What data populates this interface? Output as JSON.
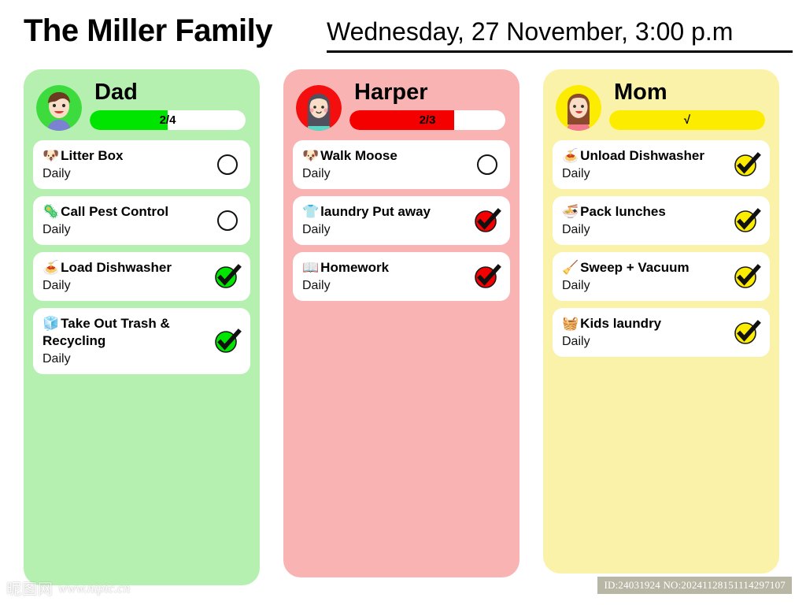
{
  "header": {
    "family_title": "The Miller Family",
    "date": "Wednesday, 27 November, 3:00 p.m"
  },
  "columns": [
    {
      "id": "dad",
      "name": "Dad",
      "panel_color": "#b6f0b0",
      "accent_color": "#00e500",
      "avatar_bg": "#3ddb3d",
      "progress": {
        "label": "2/4",
        "completed": 2,
        "total": 4,
        "percent": 50,
        "fill_color": "#00e500"
      },
      "tasks": [
        {
          "emoji": "🐶",
          "emoji_name": "dog-face-icon",
          "title": "Litter Box",
          "frequency": "Daily",
          "done": false
        },
        {
          "emoji": "🦠",
          "emoji_name": "microbe-icon",
          "title": "Call Pest Control",
          "frequency": "Daily",
          "done": false
        },
        {
          "emoji": "🍝",
          "emoji_name": "spaghetti-icon",
          "title": "Load Dishwasher",
          "frequency": "Daily",
          "done": true
        },
        {
          "emoji": "🧊",
          "emoji_name": "ice-cube-icon",
          "title": "Take Out Trash & Recycling",
          "frequency": "Daily",
          "done": true
        }
      ]
    },
    {
      "id": "harper",
      "name": "Harper",
      "panel_color": "#f9b3b3",
      "accent_color": "#f40000",
      "avatar_bg": "#f40e0e",
      "progress": {
        "label": "2/3",
        "completed": 2,
        "total": 3,
        "percent": 67,
        "fill_color": "#f40000"
      },
      "tasks": [
        {
          "emoji": "🐶",
          "emoji_name": "dog-face-icon",
          "title": "Walk Moose",
          "frequency": "Daily",
          "done": false
        },
        {
          "emoji": "👕",
          "emoji_name": "t-shirt-icon",
          "title": "laundry Put away",
          "frequency": "Daily",
          "done": true
        },
        {
          "emoji": "📖",
          "emoji_name": "open-book-icon",
          "title": "Homework",
          "frequency": "Daily",
          "done": true
        }
      ]
    },
    {
      "id": "mom",
      "name": "Mom",
      "panel_color": "#faf2a8",
      "accent_color": "#fced00",
      "avatar_bg": "#fced00",
      "progress": {
        "label": "√",
        "completed": 4,
        "total": 4,
        "percent": 100,
        "fill_color": "#fced00"
      },
      "tasks": [
        {
          "emoji": "🍝",
          "emoji_name": "spaghetti-icon",
          "title": "Unload Dishwasher",
          "frequency": "Daily",
          "done": true
        },
        {
          "emoji": "🍜",
          "emoji_name": "ramen-bowl-icon",
          "title": "Pack lunches",
          "frequency": "Daily",
          "done": true
        },
        {
          "emoji": "🧹",
          "emoji_name": "broom-icon",
          "title": "Sweep + Vacuum",
          "frequency": "Daily",
          "done": true
        },
        {
          "emoji": "🧺",
          "emoji_name": "basket-icon",
          "title": "Kids laundry",
          "frequency": "Daily",
          "done": true
        }
      ]
    }
  ],
  "watermarks": {
    "site_name_cn": "昵图网",
    "site_url": "www.nipic.cn",
    "image_id": "ID:24031924 NO:20241128151114297107"
  }
}
